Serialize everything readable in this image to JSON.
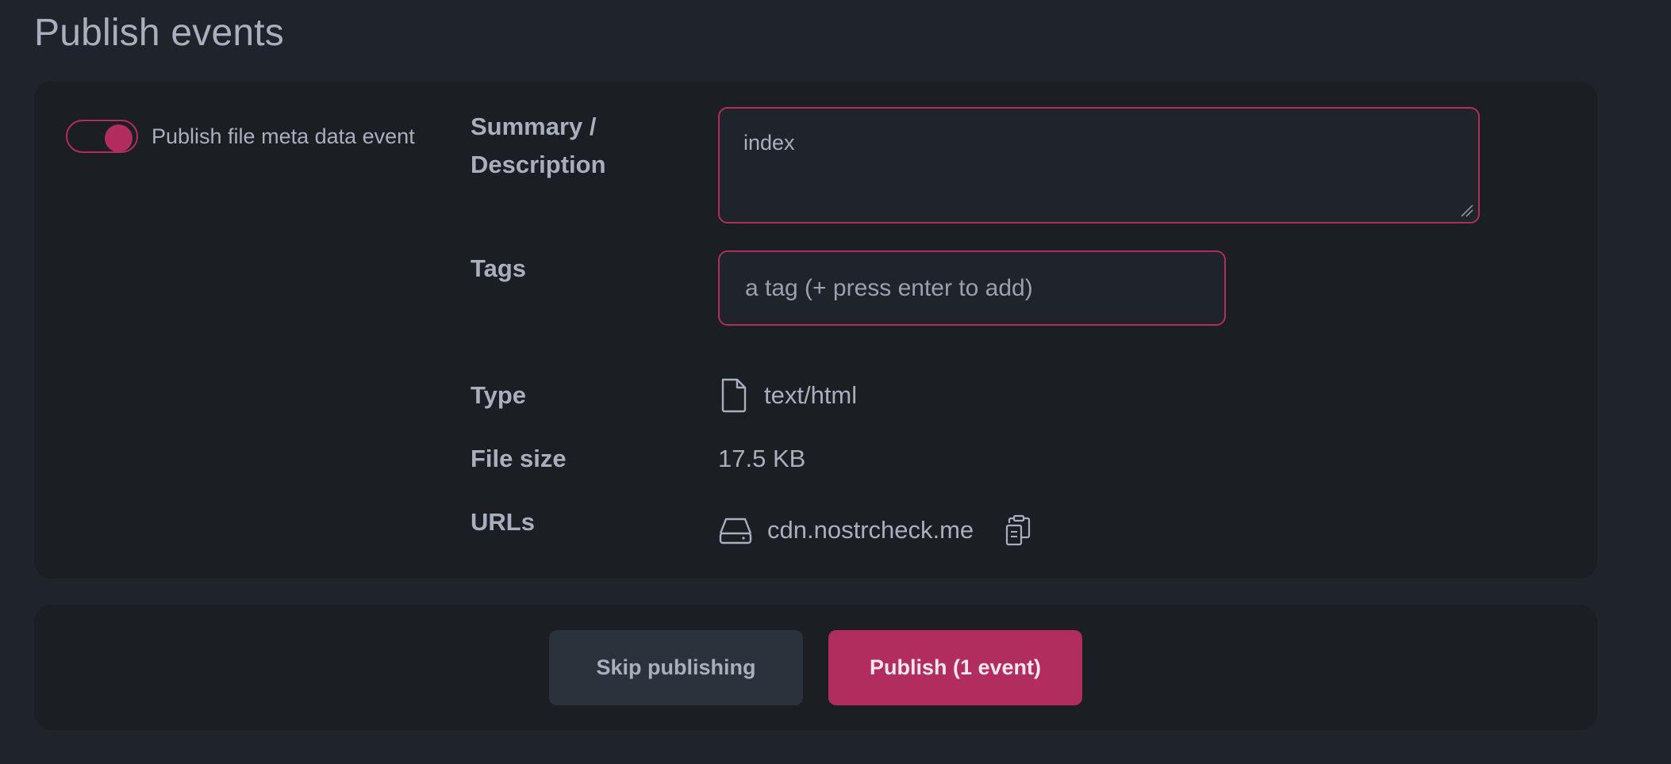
{
  "page": {
    "title": "Publish events"
  },
  "colors": {
    "accent": "#b02d5d",
    "background": "#1f232a",
    "card": "#1b1e23",
    "text": "#a9afbd"
  },
  "toggle": {
    "label": "Publish file meta data event",
    "checked": true
  },
  "form": {
    "summary_label": "Summary / Description",
    "summary_value": "index",
    "tags_label": "Tags",
    "tags_placeholder": "a tag (+ press enter to add)",
    "type_label": "Type",
    "type_icon": "file-icon",
    "type_value": "text/html",
    "size_label": "File size",
    "size_value": "17.5 KB",
    "urls_label": "URLs",
    "url_icon": "hard-drive-icon",
    "url_value": "cdn.nostrcheck.me",
    "copy_icon": "clipboard-copy-icon"
  },
  "actions": {
    "skip_label": "Skip publishing",
    "publish_label": "Publish (1 event)"
  }
}
